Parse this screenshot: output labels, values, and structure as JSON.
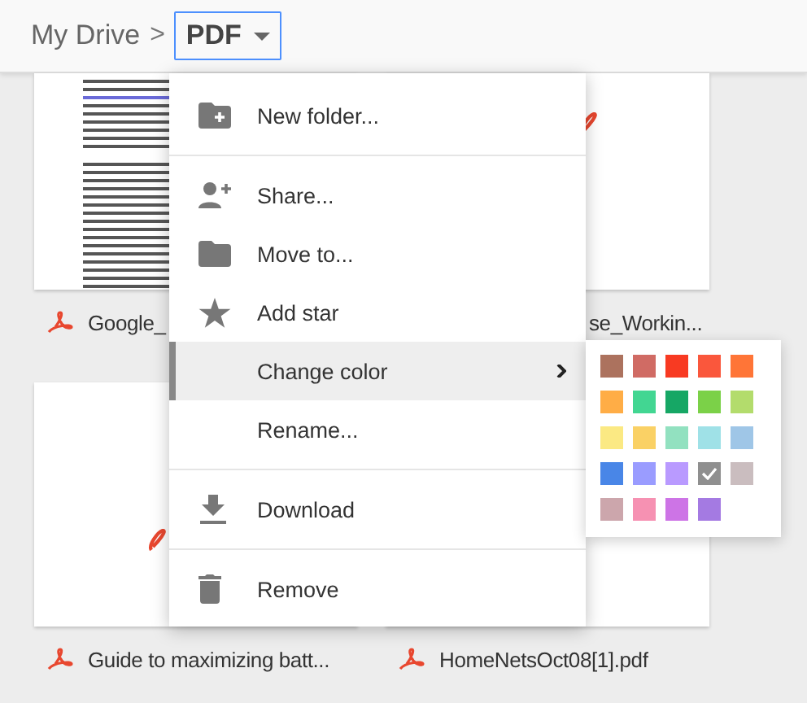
{
  "breadcrumb": {
    "root": "My Drive",
    "separator": ">",
    "current": "PDF"
  },
  "files": [
    {
      "name": "Google_"
    },
    {
      "name": "se_Workin..."
    },
    {
      "name": "Guide to maximizing batt..."
    },
    {
      "name": "HomeNetsOct08[1].pdf"
    }
  ],
  "menu": [
    {
      "kind": "item",
      "label": "New folder...",
      "selected": false
    },
    {
      "kind": "divider"
    },
    {
      "kind": "item",
      "label": "Share...",
      "selected": false
    },
    {
      "kind": "item",
      "label": "Move to...",
      "selected": false
    },
    {
      "kind": "item",
      "label": "Add star",
      "selected": false
    },
    {
      "kind": "submenu",
      "label": "Change color",
      "selected": true
    },
    {
      "kind": "item",
      "label": "Rename...",
      "selected": false
    },
    {
      "kind": "divider"
    },
    {
      "kind": "item",
      "label": "Download",
      "selected": false
    },
    {
      "kind": "divider"
    },
    {
      "kind": "item",
      "label": "Remove",
      "selected": false
    }
  ],
  "palette": [
    {
      "color": "#ac725e",
      "selected": false
    },
    {
      "color": "#d06b64",
      "selected": false
    },
    {
      "color": "#f83a22",
      "selected": false
    },
    {
      "color": "#fa573c",
      "selected": false
    },
    {
      "color": "#ff7537",
      "selected": false
    },
    {
      "color": "#ffad46",
      "selected": false
    },
    {
      "color": "#42d692",
      "selected": false
    },
    {
      "color": "#16a765",
      "selected": false
    },
    {
      "color": "#7bd148",
      "selected": false
    },
    {
      "color": "#b3dc6c",
      "selected": false
    },
    {
      "color": "#fbe983",
      "selected": false
    },
    {
      "color": "#fad165",
      "selected": false
    },
    {
      "color": "#92e1c0",
      "selected": false
    },
    {
      "color": "#9fe1e7",
      "selected": false
    },
    {
      "color": "#9fc6e7",
      "selected": false
    },
    {
      "color": "#4986e7",
      "selected": false
    },
    {
      "color": "#9a9cff",
      "selected": false
    },
    {
      "color": "#b99aff",
      "selected": false
    },
    {
      "color": "#8f8f8f",
      "selected": true
    },
    {
      "color": "#cabdbf",
      "selected": false
    },
    {
      "color": "#cca6ac",
      "selected": false
    },
    {
      "color": "#f691b2",
      "selected": false
    },
    {
      "color": "#cd74e6",
      "selected": false
    },
    {
      "color": "#a47ae2",
      "selected": false
    }
  ]
}
